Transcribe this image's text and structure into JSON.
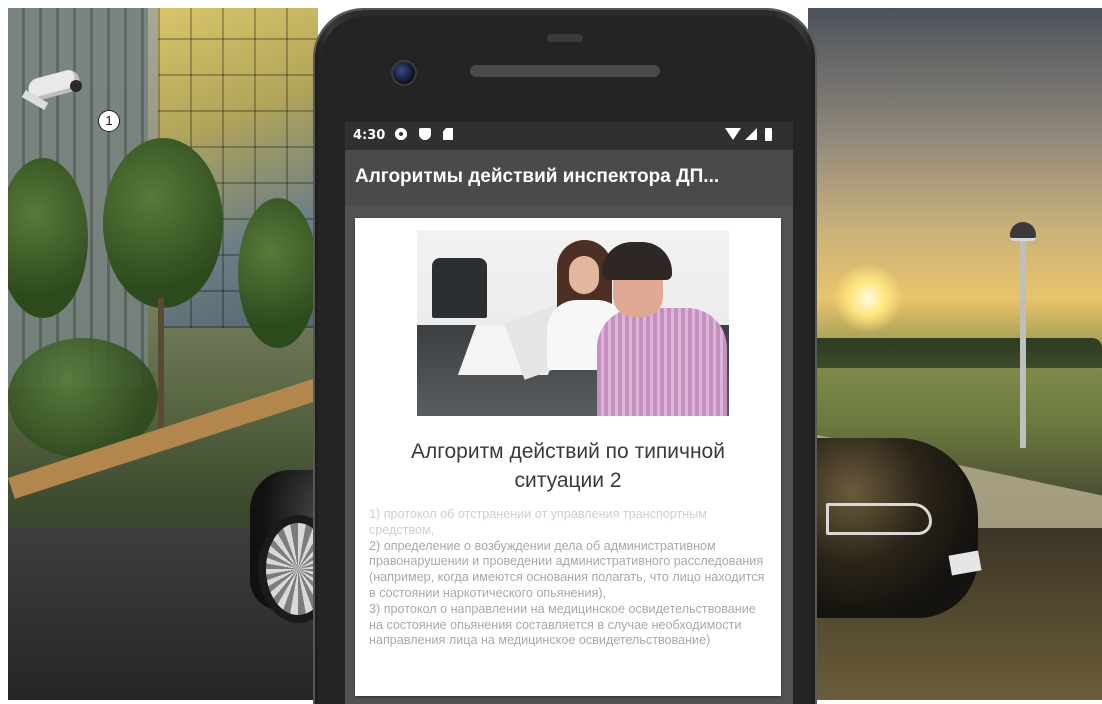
{
  "overlay": {
    "camera_badge": "1",
    "icon": "cctv-camera-icon"
  },
  "phone": {
    "status_bar": {
      "time": "4:30",
      "left_icons": [
        "gear-icon",
        "shield-icon",
        "sd-card-icon"
      ],
      "right_icons": [
        "wifi-icon",
        "signal-icon",
        "battery-icon"
      ]
    },
    "app_bar": {
      "title": "Алгоритмы действий инспектора ДП..."
    },
    "card": {
      "heading": "Алгоритм действий по типичной ситуации 2",
      "body_text_line1": "1) протокол об отстранении от управления транспортным средством,",
      "body_text_rest": "2) определение о возбуждении дела об административном правонарушении и проведении административного расследования (например, когда имеются основания полагать, что лицо находится в состоянии наркотического опьянения),\n3) протокол о направлении на медицинское освидетельствование на состояние опьянения составляется в случае необходимости направления лица на медицинское освидетельствование)"
    }
  },
  "colors": {
    "status_bar": "#303030",
    "app_bar": "#4a4a4a",
    "screen_bg": "#525252",
    "card_bg": "#ffffff",
    "heading_text": "#3a3a3a",
    "body_text": "#a8a8a8"
  }
}
